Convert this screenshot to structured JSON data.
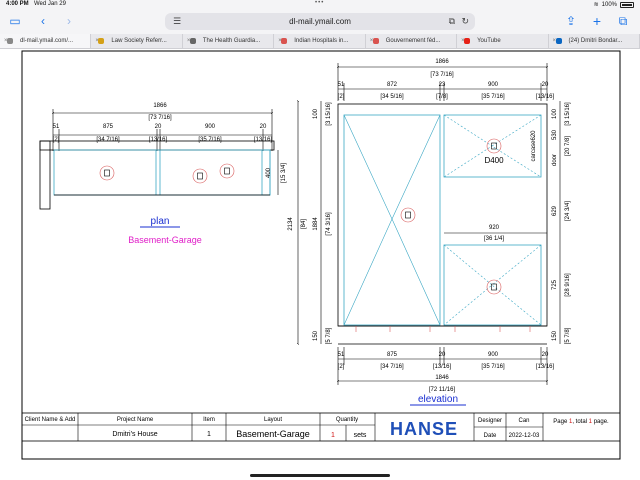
{
  "status": {
    "time": "4:00 PM",
    "date": "Wed Jan 29",
    "battery": "100%"
  },
  "browser": {
    "url": "dl-mail.ymail.com",
    "tabs": [
      {
        "label": "dl-mail.ymail.com/...",
        "color": "#888888"
      },
      {
        "label": "Law Society Referr...",
        "color": "#d4a017"
      },
      {
        "label": "The Health Guardia...",
        "color": "#666666"
      },
      {
        "label": "Indian Hospitals in...",
        "color": "#d9534f"
      },
      {
        "label": "Gouvernement féd...",
        "color": "#d9534f"
      },
      {
        "label": "YouTube",
        "color": "#e62117"
      },
      {
        "label": "(24) Dmitri Bondar...",
        "color": "#0a66c2"
      }
    ]
  },
  "drawing": {
    "plan": {
      "total_mm": "1866",
      "total_in": "[73 7/16]",
      "segs_mm": [
        "51",
        "875",
        "20",
        "900",
        "20"
      ],
      "segs_in": [
        "[2]",
        "[34 7/16]",
        "[13/16]",
        "[35 7/16]",
        "[13/16]"
      ],
      "depth_mm": "400",
      "depth_in": "[15 3/4]",
      "label": "plan",
      "sublabel": "Basement-Garage"
    },
    "elevation": {
      "total_mm": "1866",
      "total_in": "[73 7/16]",
      "top_segs_mm": [
        "51",
        "872",
        "23",
        "900",
        "20"
      ],
      "top_segs_in": [
        "[2]",
        "[34 5/16]",
        "[7/8]",
        "[35 7/16]",
        "[13/16]"
      ],
      "height_total_mm": "2134",
      "height_total_in": "[84]",
      "height_body_mm": "1884",
      "height_body_in": "[74 3/16]",
      "top_gap_mm": "100",
      "top_gap_in": "[3 15/16]",
      "base_mm": "150",
      "base_in": "[5 7/8]",
      "door_mm": "530",
      "door_in": "[20 7/8]",
      "door_label": "door",
      "carcass_label": "carcase620",
      "mid_mm": "629",
      "mid_in": "[24 3/4]",
      "lower_mm": "725",
      "lower_in": "[28 9/16]",
      "right_base_mm": "150",
      "right_base_in": "[5 7/8]",
      "inner_w_mm": "920",
      "inner_w_in": "[36 1/4]",
      "code": "D400",
      "bot_segs_mm": [
        "51",
        "875",
        "20",
        "900",
        "20"
      ],
      "bot_segs_in": [
        "[2]",
        "[34 7/16]",
        "[13/16]",
        "[35 7/16]",
        "[13/16]"
      ],
      "bot_total_mm": "1846",
      "bot_total_in": "[72 11/16]",
      "label": "elevation"
    },
    "title_block": {
      "client_label": "Client Name & Add",
      "project_label": "Project Name",
      "project_value": "Dmitri's House",
      "item_label": "Item",
      "item_value": "1",
      "layout_label": "Layout",
      "layout_value": "Basement-Garage",
      "quantity_label": "Quantity",
      "quantity_value": "1",
      "quantity_unit": "sets",
      "brand": "HANSE",
      "designer_label": "Designer",
      "designer_value": "Can",
      "date_label": "Date",
      "date_value": "2022-12-03",
      "page_text_1": "Page",
      "page_num": "1",
      "page_text_2": ", total",
      "page_total": "1",
      "page_text_3": "page."
    }
  }
}
